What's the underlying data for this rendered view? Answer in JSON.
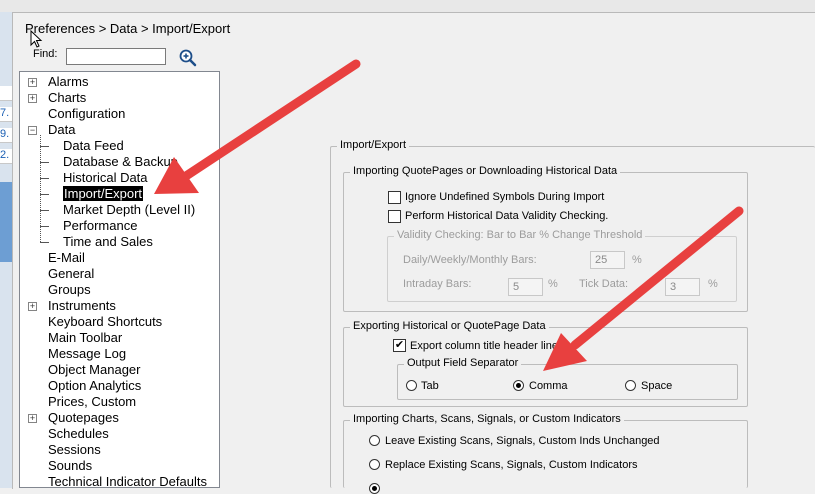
{
  "window": {
    "title": "Preferences > Data > Import/Export"
  },
  "left_peek": [
    "",
    "7.",
    "9.",
    "2."
  ],
  "find": {
    "label": "Find:",
    "value": ""
  },
  "tree": [
    {
      "label": "Alarms",
      "expander": "+"
    },
    {
      "label": "Charts",
      "expander": "+"
    },
    {
      "label": "Configuration"
    },
    {
      "label": "Data",
      "expander": "−"
    },
    {
      "label": "Data Feed",
      "child": true
    },
    {
      "label": "Database & Backup",
      "child": true
    },
    {
      "label": "Historical Data",
      "child": true
    },
    {
      "label": "Import/Export",
      "child": true,
      "selected": true
    },
    {
      "label": "Market Depth (Level II)",
      "child": true
    },
    {
      "label": "Performance",
      "child": true
    },
    {
      "label": "Time and Sales",
      "child": true
    },
    {
      "label": "E-Mail"
    },
    {
      "label": "General"
    },
    {
      "label": "Groups"
    },
    {
      "label": "Instruments",
      "expander": "+"
    },
    {
      "label": "Keyboard Shortcuts"
    },
    {
      "label": "Main Toolbar"
    },
    {
      "label": "Message Log"
    },
    {
      "label": "Object Manager"
    },
    {
      "label": "Option Analytics"
    },
    {
      "label": "Prices, Custom"
    },
    {
      "label": "Quotepages",
      "expander": "+"
    },
    {
      "label": "Schedules"
    },
    {
      "label": "Sessions"
    },
    {
      "label": "Sounds"
    },
    {
      "label": "Technical Indicator Defaults"
    }
  ],
  "panel": {
    "title": "Import/Export",
    "importing": {
      "title": "Importing QuotePages or Downloading Historical Data",
      "ignore_undefined": {
        "label": "Ignore Undefined Symbols During Import",
        "checked": false
      },
      "validity_check": {
        "label": "Perform Historical Data Validity Checking.",
        "checked": false
      },
      "threshold": {
        "title": "Validity Checking: Bar to Bar % Change Threshold",
        "daily_label": "Daily/Weekly/Monthly Bars:",
        "daily_value": "25",
        "intraday_label": "Intraday Bars:",
        "intraday_value": "5",
        "tick_label": "Tick Data:",
        "tick_value": "3",
        "pct": "%"
      }
    },
    "exporting": {
      "title": "Exporting Historical or QuotePage Data",
      "header_line": {
        "label": "Export column title header line",
        "checked": true
      },
      "separator": {
        "title": "Output Field Separator",
        "options": [
          "Tab",
          "Comma",
          "Space"
        ],
        "selected": "Comma"
      }
    },
    "charts": {
      "title": "Importing Charts, Scans, Signals, or Custom Indicators",
      "options": [
        "Leave Existing Scans, Signals, Custom Inds Unchanged",
        "Replace Existing Scans, Signals, Custom Indicators",
        ""
      ]
    }
  },
  "colors": {
    "arrow": "#e8403f",
    "selection": "#000000"
  }
}
